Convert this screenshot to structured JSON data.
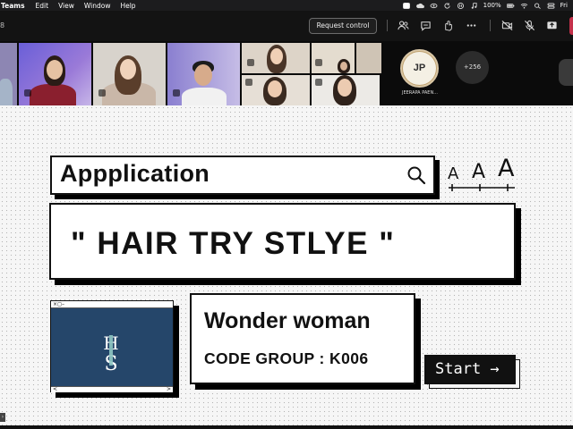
{
  "menubar": {
    "app_name": "Teams",
    "menus": [
      "Edit",
      "View",
      "Window",
      "Help"
    ],
    "battery": "100%",
    "date": "Fri"
  },
  "toolbar": {
    "timer_fragment": "8",
    "request_control_label": "Request control"
  },
  "participants": {
    "featured_initials": "JP",
    "featured_name": "JEERAPA PAEN...",
    "more_count": "+256"
  },
  "slide": {
    "app_title": "Appplication",
    "main_title": "\" HAIR TRY STLYE \"",
    "team_name": "Wonder woman",
    "code_group": "CODE GROUP : K006",
    "start_label": "Start →",
    "logo_letters": "HS",
    "window_controls": "×◻–",
    "scroll_left": "<",
    "scroll_right": ">",
    "font_size_glyphs": [
      "A",
      "A",
      "A"
    ]
  },
  "colors": {
    "logo_bg": "#25466a",
    "leave_red": "#c4314b",
    "slide_bg": "#f6f6f6"
  }
}
